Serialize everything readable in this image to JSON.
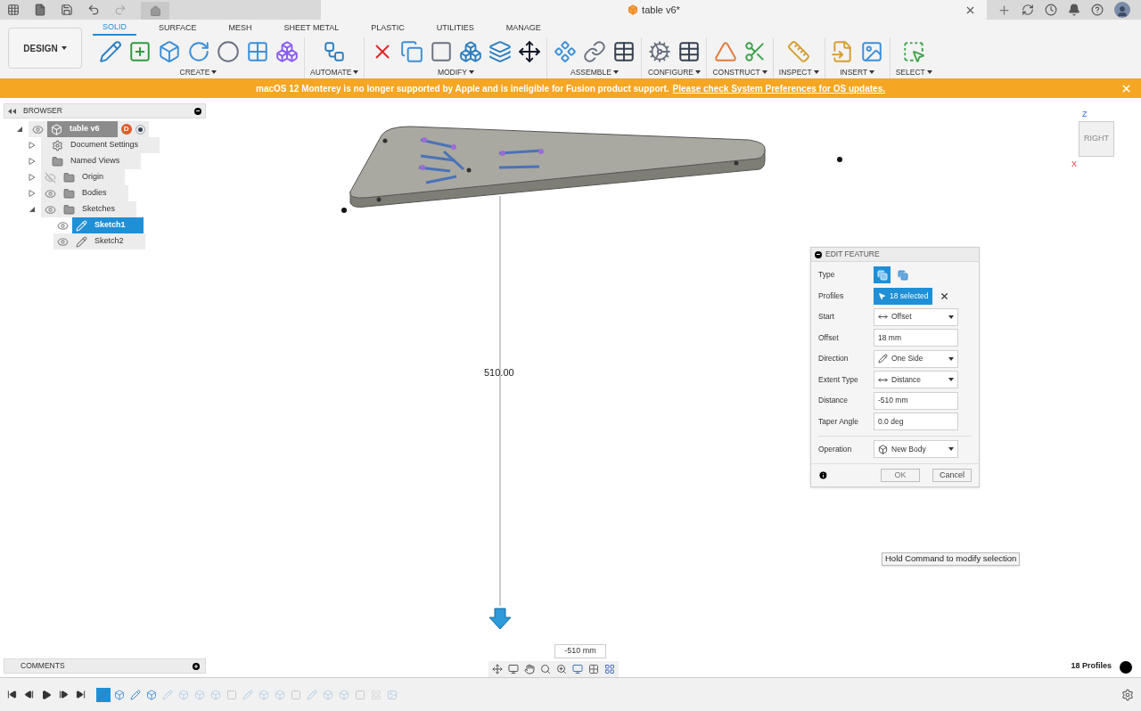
{
  "window": {
    "title": "table v6*"
  },
  "workspace": {
    "label": "DESIGN"
  },
  "toolbar_tabs": [
    {
      "label": "SOLID",
      "selected": true
    },
    {
      "label": "SURFACE",
      "selected": false
    },
    {
      "label": "MESH",
      "selected": false
    },
    {
      "label": "SHEET METAL",
      "selected": false
    },
    {
      "label": "PLASTIC",
      "selected": false
    },
    {
      "label": "UTILITIES",
      "selected": false
    },
    {
      "label": "MANAGE",
      "selected": false
    }
  ],
  "toolbar_groups": [
    {
      "label": "CREATE",
      "tools": [
        {
          "kind": "sketch"
        },
        {
          "kind": "sketch-add"
        },
        {
          "kind": "extrude"
        },
        {
          "kind": "revolve"
        },
        {
          "kind": "hole"
        },
        {
          "kind": "pattern"
        },
        {
          "kind": "form"
        }
      ]
    },
    {
      "label": "AUTOMATE",
      "tools": [
        {
          "kind": "automate"
        }
      ]
    },
    {
      "label": "MODIFY",
      "tools": [
        {
          "kind": "delete"
        },
        {
          "kind": "press-pull"
        },
        {
          "kind": "fillet"
        },
        {
          "kind": "combine"
        },
        {
          "kind": "split"
        },
        {
          "kind": "move"
        }
      ]
    },
    {
      "label": "ASSEMBLE",
      "tools": [
        {
          "kind": "component"
        },
        {
          "kind": "joint"
        },
        {
          "kind": "table"
        }
      ]
    },
    {
      "label": "CONFIGURE",
      "tools": [
        {
          "kind": "configure"
        },
        {
          "kind": "table"
        }
      ]
    },
    {
      "label": "CONSTRUCT",
      "tools": [
        {
          "kind": "plane"
        },
        {
          "kind": "midplane"
        }
      ]
    },
    {
      "label": "INSPECT",
      "tools": [
        {
          "kind": "measure"
        }
      ]
    },
    {
      "label": "INSERT",
      "tools": [
        {
          "kind": "insert-svg"
        },
        {
          "kind": "image"
        }
      ]
    },
    {
      "label": "SELECT",
      "tools": [
        {
          "kind": "select"
        }
      ]
    }
  ],
  "banner": {
    "text": "macOS 12 Monterey is no longer supported by Apple and is ineligible for Fusion product support.",
    "link": "Please check System Preferences for OS updates."
  },
  "browser": {
    "title": "BROWSER",
    "tree": [
      {
        "label": "table v6",
        "kind": "component",
        "badge": "D",
        "visible": true,
        "expanded": true,
        "selected": false,
        "children": [
          {
            "label": "Document Settings",
            "kind": "settings",
            "expanded": false,
            "selected": false
          },
          {
            "label": "Named Views",
            "kind": "folder",
            "expanded": false,
            "selected": false
          },
          {
            "label": "Origin",
            "kind": "folder",
            "visible": false,
            "expanded": false,
            "selected": false
          },
          {
            "label": "Bodies",
            "kind": "folder",
            "visible": true,
            "expanded": false,
            "selected": false
          },
          {
            "label": "Sketches",
            "kind": "folder",
            "visible": true,
            "expanded": true,
            "selected": false,
            "children": [
              {
                "label": "Sketch1",
                "kind": "sketch",
                "visible": true,
                "selected": true
              },
              {
                "label": "Sketch2",
                "kind": "sketch",
                "visible": true,
                "selected": false
              }
            ]
          }
        ]
      }
    ]
  },
  "viewport": {
    "dimension": "510.00",
    "tooltip": "Hold Command to modify selection",
    "view_cube": {
      "face": "RIGHT",
      "axis_z": "Z",
      "axis_x": "X"
    },
    "distance_field": "-510 mm",
    "status": "18 Profiles"
  },
  "dialog": {
    "title": "EDIT FEATURE",
    "rows": [
      {
        "label": "Type",
        "kind": "toggle",
        "options": [
          {
            "selected": true
          },
          {
            "selected": false
          }
        ]
      },
      {
        "label": "Profiles",
        "kind": "selection",
        "value": "18 selected"
      },
      {
        "label": "Start",
        "kind": "dropdown",
        "value": "Offset"
      },
      {
        "label": "Offset",
        "kind": "input",
        "value": "18 mm"
      },
      {
        "label": "Direction",
        "kind": "dropdown",
        "value": "One Side"
      },
      {
        "label": "Extent Type",
        "kind": "dropdown",
        "value": "Distance"
      },
      {
        "label": "Distance",
        "kind": "input",
        "value": "-510 mm"
      },
      {
        "label": "Taper Angle",
        "kind": "input",
        "value": "0.0 deg"
      },
      {
        "label": "Operation",
        "kind": "dropdown",
        "value": "New Body"
      }
    ],
    "buttons": [
      "OK",
      "Cancel"
    ]
  },
  "comments": {
    "title": "COMMENTS"
  },
  "timeline": {
    "features": [
      {
        "kind": "sketch",
        "selected": true,
        "rolled_back": false
      },
      {
        "kind": "extrude",
        "selected": false,
        "rolled_back": false
      },
      {
        "kind": "sketch",
        "selected": false,
        "rolled_back": false
      },
      {
        "kind": "extrude",
        "selected": false,
        "rolled_back": false
      },
      {
        "kind": "sketch",
        "selected": false,
        "rolled_back": true
      },
      {
        "kind": "extrude",
        "selected": false,
        "rolled_back": true
      },
      {
        "kind": "extrude",
        "selected": false,
        "rolled_back": true
      },
      {
        "kind": "extrude",
        "selected": false,
        "rolled_back": true
      },
      {
        "kind": "fillet",
        "selected": false,
        "rolled_back": true
      },
      {
        "kind": "sketch",
        "selected": false,
        "rolled_back": true
      },
      {
        "kind": "extrude",
        "selected": false,
        "rolled_back": true
      },
      {
        "kind": "extrude",
        "selected": false,
        "rolled_back": true
      },
      {
        "kind": "fillet",
        "selected": false,
        "rolled_back": true
      },
      {
        "kind": "sketch",
        "selected": false,
        "rolled_back": true
      },
      {
        "kind": "extrude",
        "selected": false,
        "rolled_back": true
      },
      {
        "kind": "extrude",
        "selected": false,
        "rolled_back": true
      },
      {
        "kind": "fillet",
        "selected": false,
        "rolled_back": true
      },
      {
        "kind": "group",
        "selected": false,
        "rolled_back": true
      },
      {
        "kind": "image",
        "selected": false,
        "rolled_back": true
      }
    ]
  }
}
